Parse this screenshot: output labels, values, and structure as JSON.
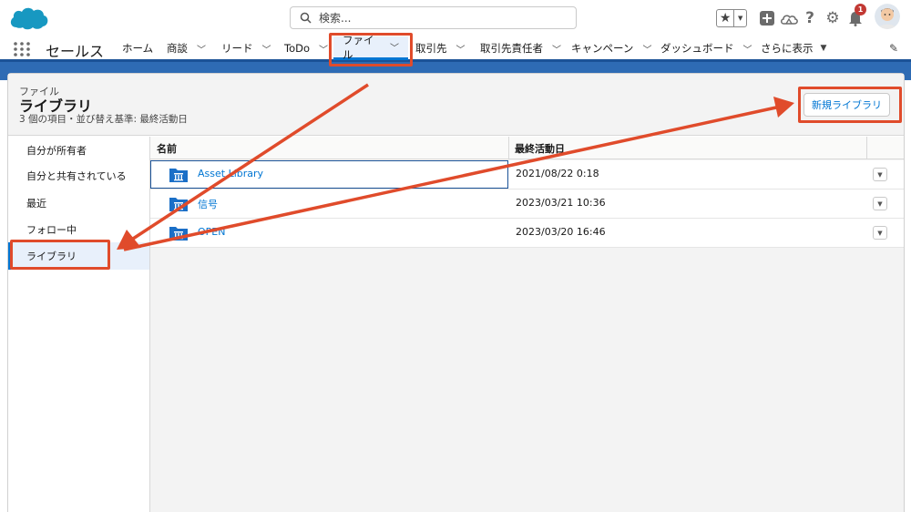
{
  "header": {
    "search_placeholder": "検索...",
    "notification_count": "1"
  },
  "nav": {
    "app_name": "セールス",
    "items": [
      {
        "label": "ホーム"
      },
      {
        "label": "商談"
      },
      {
        "label": "リード"
      },
      {
        "label": "ToDo"
      },
      {
        "label": "ファイル"
      },
      {
        "label": "取引先"
      },
      {
        "label": "取引先責任者"
      },
      {
        "label": "キャンペーン"
      },
      {
        "label": "ダッシュボード"
      },
      {
        "label": "さらに表示"
      }
    ]
  },
  "page": {
    "breadcrumb": "ファイル",
    "title": "ライブラリ",
    "subtitle": "3 個の項目・並び替え基準: 最終活動日",
    "new_library_button": "新規ライブラリ"
  },
  "sidebar": {
    "items": [
      {
        "label": "自分が所有者"
      },
      {
        "label": "自分と共有されている"
      },
      {
        "label": "最近"
      },
      {
        "label": "フォロー中"
      },
      {
        "label": "ライブラリ"
      }
    ]
  },
  "table": {
    "columns": [
      "名前",
      "最終活動日"
    ],
    "rows": [
      {
        "name": "Asset Library",
        "date": "2021/08/22 0:18"
      },
      {
        "name": "信号",
        "date": "2023/03/21 10:36"
      },
      {
        "name": "OPEN",
        "date": "2023/03/20 16:46"
      }
    ]
  },
  "colors": {
    "accent": "#0176d3",
    "annotation": "#e04b2b",
    "brand_band": "#2e6bb4"
  }
}
